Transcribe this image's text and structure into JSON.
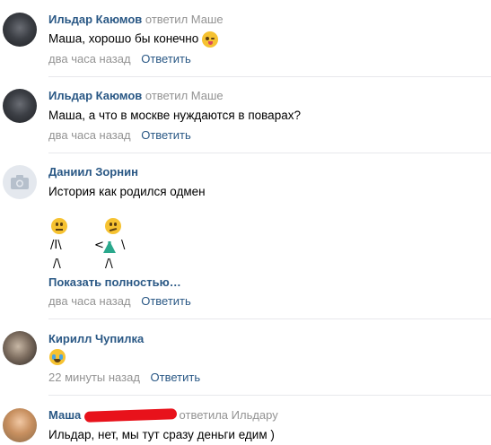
{
  "comments": [
    {
      "author": "Ильдар Каюмов",
      "reply_to": "ответил Маше",
      "text": "Маша, хорошо бы конечно",
      "emoji": "winking-tongue-emoji",
      "time": "два часа назад",
      "reply_label": "Ответить"
    },
    {
      "author": "Ильдар Каюмов",
      "reply_to": "ответил Маше",
      "text": "Маша, а что в москве нуждаются в поварах?",
      "time": "два часа назад",
      "reply_label": "Ответить"
    },
    {
      "author": "Даниил Зорнин",
      "text": "История как родился одмен",
      "art": {
        "left_body": "/I\\",
        "left_legs": "/\\",
        "right_body_left": "<",
        "right_body_right": "\\",
        "right_legs": "/\\"
      },
      "show_more": "Показать полностью…",
      "time": "два часа назад",
      "reply_label": "Ответить"
    },
    {
      "author": "Кирилл Чупилка",
      "emoji": "crying-laughing-emoji",
      "time": "22 минуты назад",
      "reply_label": "Ответить"
    },
    {
      "author": "Маша",
      "reply_to": "ответила Ильдару",
      "text": "Ильдар, нет, мы тут сразу деньги едим )"
    }
  ],
  "colors": {
    "link": "#2a5885",
    "meta": "#939393",
    "divider": "#e7e8ec",
    "redaction": "#e8121b"
  }
}
